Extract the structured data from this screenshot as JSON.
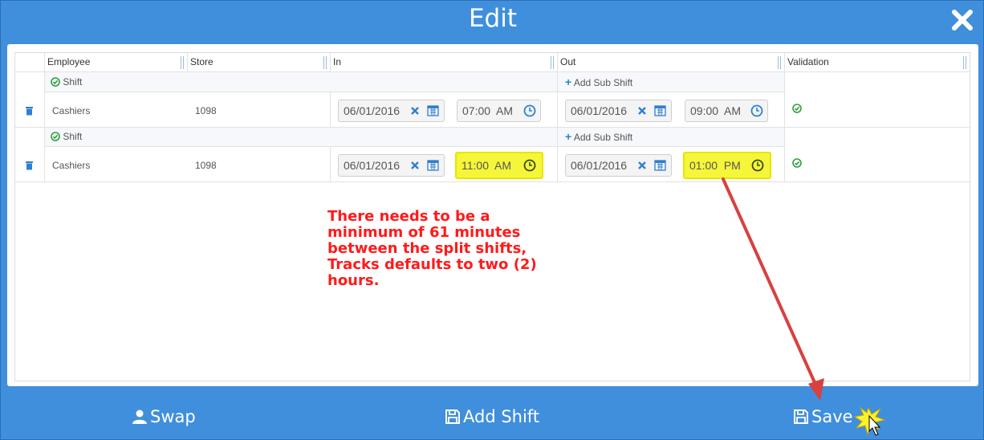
{
  "dialog": {
    "title": "Edit"
  },
  "table": {
    "headers": [
      "Employee",
      "Store",
      "In",
      "Out",
      "Validation"
    ],
    "shift_label": "Shift",
    "add_sub_shift_label": "Add Sub Shift",
    "rows": [
      {
        "employee": "Cashiers",
        "store": "1098",
        "in_date": "06/01/2016",
        "in_time": "07:00  AM",
        "out_date": "06/01/2016",
        "out_time": "09:00  AM",
        "highlighted": false
      },
      {
        "employee": "Cashiers",
        "store": "1098",
        "in_date": "06/01/2016",
        "in_time": "11:00  AM",
        "out_date": "06/01/2016",
        "out_time": "01:00  PM",
        "highlighted": true
      }
    ]
  },
  "annotation": {
    "text": "There needs to be a minimum of 61 minutes between the split shifts, Tracks defaults to two (2) hours."
  },
  "footer": {
    "swap_label": "Swap",
    "add_shift_label": "Add Shift",
    "save_label": "Save"
  },
  "colors": {
    "header_blue": "#3f8fdc",
    "highlight_yellow": "#f5f53a",
    "annotation_red": "#ff1a1a",
    "valid_green": "#2e9e3e"
  }
}
